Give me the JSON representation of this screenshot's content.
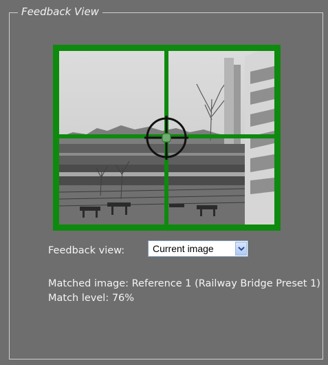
{
  "panel": {
    "legend": "Feedback View"
  },
  "feedback": {
    "label": "Feedback view:",
    "selected": "Current image"
  },
  "match": {
    "matched_image": "Matched image: Reference 1 (Railway Bridge Preset 1)",
    "match_level": "Match level: 76%",
    "match_level_value": 76
  },
  "icons": {
    "dropdown": "chevron-down-icon",
    "reticle": "crosshair-icon"
  },
  "colors": {
    "grid": "#0e8a0e",
    "background": "#6e6e6e",
    "text": "#f4f4f4"
  }
}
